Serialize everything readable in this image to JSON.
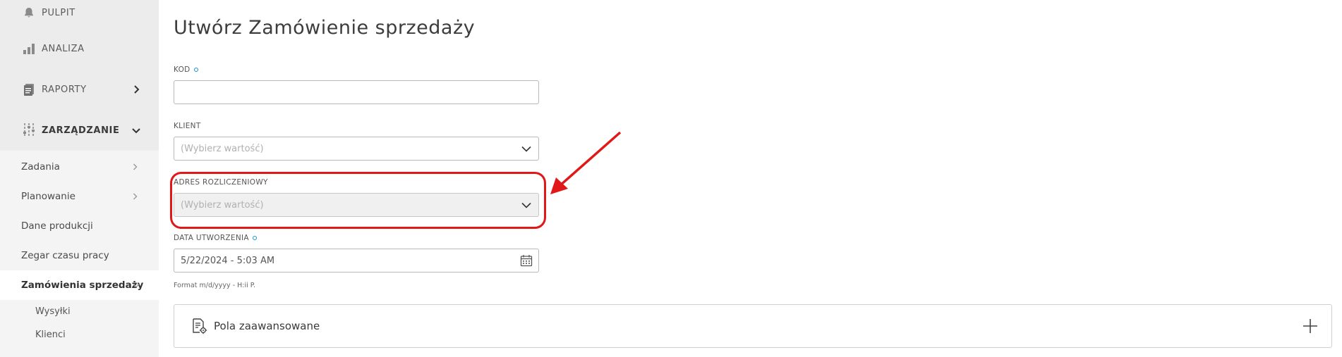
{
  "sidebar": {
    "main_items": [
      {
        "label": "PULPIT",
        "icon": "bell-icon"
      },
      {
        "label": "ANALIZA",
        "icon": "bar-chart-icon"
      },
      {
        "label": "RAPORTY",
        "icon": "report-icon"
      },
      {
        "label": "ZARZĄDZANIE",
        "icon": "sliders-icon"
      }
    ],
    "sub_items": [
      {
        "label": "Zadania"
      },
      {
        "label": "Planowanie"
      },
      {
        "label": "Dane produkcji"
      },
      {
        "label": "Zegar czasu pracy"
      },
      {
        "label": "Zamówienia sprzedaży"
      }
    ],
    "sub2_items": [
      {
        "label": "Wysyłki"
      },
      {
        "label": "Klienci"
      }
    ]
  },
  "form": {
    "title": "Utwórz Zamówienie sprzedaży",
    "fields": {
      "kod": {
        "label": "KOD",
        "required": true,
        "value": ""
      },
      "klient": {
        "label": "KLIENT",
        "placeholder": "(Wybierz wartość)"
      },
      "adres": {
        "label": "ADRES ROZLICZENIOWY",
        "placeholder": "(Wybierz wartość)",
        "disabled": true
      },
      "data": {
        "label": "DATA UTWORZENIA",
        "required": true,
        "value": "5/22/2024 - 5:03 AM",
        "hint": "Format m/d/yyyy - H:ii P."
      }
    },
    "advanced": {
      "label": "Pola zaawansowane"
    }
  },
  "colors": {
    "annotation": "#e01818",
    "required_dot": "#1a8fd6",
    "sidebar_bg": "#f4f4f4"
  }
}
